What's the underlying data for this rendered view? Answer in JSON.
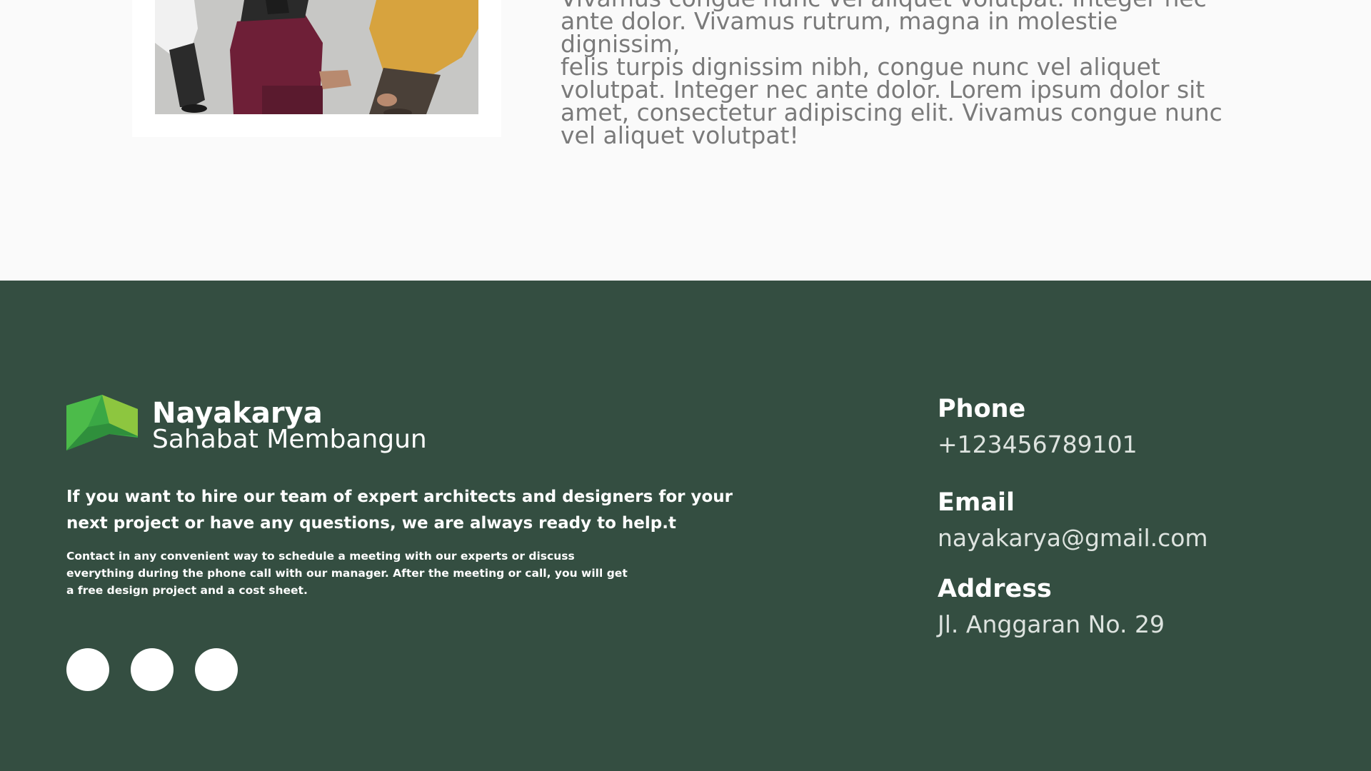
{
  "about": {
    "text": "Vivamus congue nunc vel aliquet volutpat. Integer nec\nante dolor.  Vivamus rutrum, magna in molestie dignissim,\nfelis turpis dignissim nibh, congue nunc vel aliquet\nvolutpat. Integer nec ante dolor. Lorem ipsum dolor sit\namet, consectetur adipiscing elit. Vivamus congue nunc\nvel aliquet volutpat!"
  },
  "footer": {
    "brand": {
      "name": "Nayakarya",
      "tagline": "Sahabat Membangun",
      "logo_icon": "house-roof-logo-icon"
    },
    "lead": "If you want to hire our team of expert architects and designers for your next project or have any questions, we are always ready to help.t",
    "sub": "Contact in any convenient way to schedule a meeting with our experts or discuss everything during the phone call with our manager. After the meeting or call, you will get a free design project and a cost sheet.",
    "socials": [
      {
        "icon": "social-icon"
      },
      {
        "icon": "social-icon"
      },
      {
        "icon": "social-icon"
      }
    ],
    "contact": {
      "phone_label": "Phone",
      "phone": "+123456789101",
      "email_label": "Email",
      "email": "nayakarya@gmail.com",
      "address_label": "Address",
      "address": "Jl. Anggaran No. 29"
    }
  },
  "colors": {
    "footer_bg": "#344e41",
    "page_bg": "#fafafa",
    "logo_green_dark": "#3aa845",
    "logo_green_light": "#8dc63f"
  }
}
